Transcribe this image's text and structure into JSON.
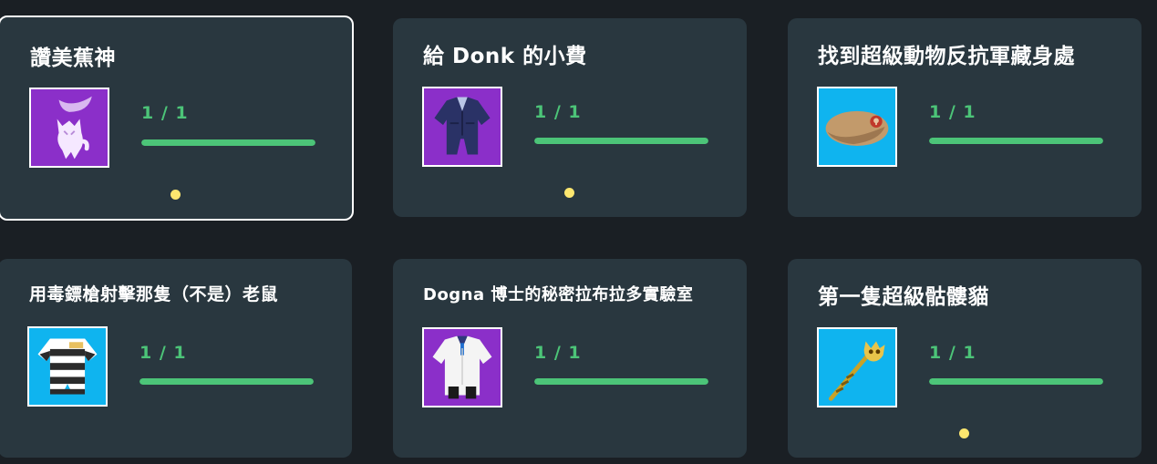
{
  "colors": {
    "background": "#1a1f24",
    "card": "#29373f",
    "progress": "#4cc478",
    "notification_dot": "#fde76f",
    "thumb_purple": "#8b2fc9",
    "thumb_blue": "#0fb4ef"
  },
  "cards": [
    {
      "title": "讚美蕉神",
      "progress": "1 / 1",
      "progress_fraction": 1.0,
      "icon": "banana-spirit-costume-icon",
      "has_new_dot": true,
      "selected": true
    },
    {
      "title": "給 Donk 的小費",
      "progress": "1 / 1",
      "progress_fraction": 1.0,
      "icon": "navy-suit-costume-icon",
      "has_new_dot": true,
      "selected": false
    },
    {
      "title": "找到超級動物反抗軍藏身處",
      "progress": "1 / 1",
      "progress_fraction": 1.0,
      "icon": "beret-hat-icon",
      "has_new_dot": false,
      "selected": false
    },
    {
      "title": "用毒鏢槍射擊那隻（不是）老鼠",
      "progress": "1 / 1",
      "progress_fraction": 1.0,
      "icon": "prisoner-outfit-icon",
      "has_new_dot": false,
      "selected": false
    },
    {
      "title": "Dogna 博士的秘密拉布拉多實驗室",
      "progress": "1 / 1",
      "progress_fraction": 1.0,
      "icon": "lab-coat-icon",
      "has_new_dot": false,
      "selected": false
    },
    {
      "title": "第一隻超級骷髏貓",
      "progress": "1 / 1",
      "progress_fraction": 1.0,
      "icon": "skull-cat-staff-icon",
      "has_new_dot": true,
      "selected": false
    }
  ]
}
